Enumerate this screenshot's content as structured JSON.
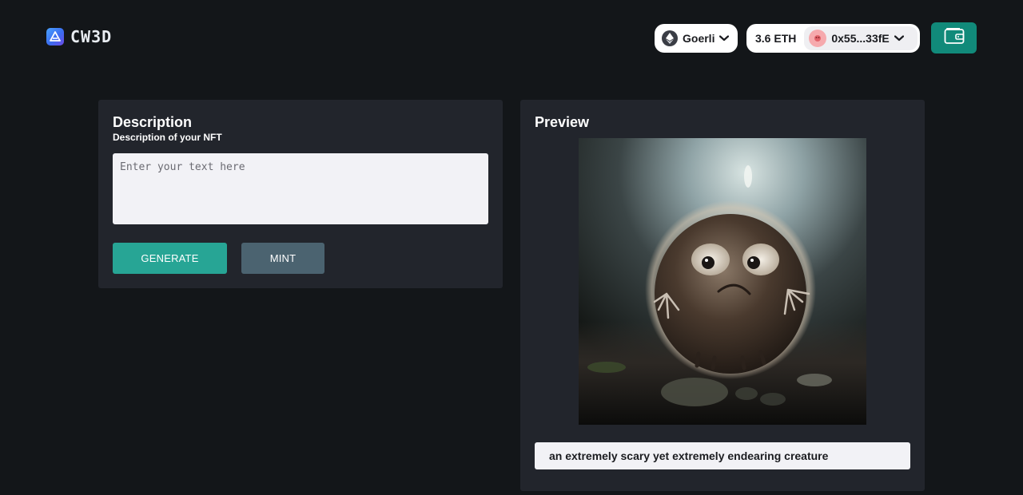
{
  "header": {
    "logo_text": "CW3D",
    "network": {
      "name": "Goerli",
      "icon": "ethereum-icon"
    },
    "account": {
      "balance": "3.6 ETH",
      "address": "0x55...33fE",
      "avatar_icon": "avatar-emoji"
    },
    "wallet_button_icon": "wallet-icon"
  },
  "description_card": {
    "title": "Description",
    "subtitle": "Description of your NFT",
    "textarea": {
      "value": "",
      "placeholder": "Enter your text here"
    },
    "generate_label": "GENERATE",
    "mint_label": "MINT"
  },
  "preview_card": {
    "title": "Preview",
    "image_alt": "preview-image",
    "caption": "an extremely scary yet extremely endearing creature"
  },
  "colors": {
    "background": "#131619",
    "card": "#22252c",
    "accent_teal": "#27a595",
    "wallet_button": "#118a7a",
    "mint_button": "#4b6370"
  }
}
